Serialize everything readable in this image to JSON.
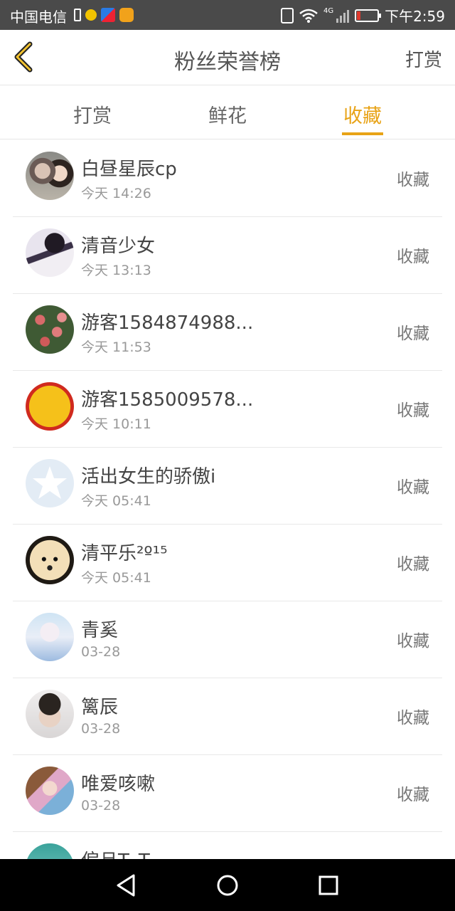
{
  "status_bar": {
    "carrier": "中国电信",
    "network": "4G",
    "time": "下午2:59",
    "icons": [
      "battery-saver-icon",
      "bulb-icon",
      "video-app-icon",
      "weibo-icon",
      "vibrate-icon",
      "wifi-icon",
      "signal-icon",
      "battery-icon"
    ]
  },
  "header": {
    "back_icon": "chevron-left-icon",
    "title": "粉丝荣誉榜",
    "action": "打赏"
  },
  "tabs": [
    {
      "label": "打赏",
      "active": false
    },
    {
      "label": "鲜花",
      "active": false
    },
    {
      "label": "收藏",
      "active": true
    }
  ],
  "accent_color": "#e8a317",
  "list": [
    {
      "name": "白昼星辰cp",
      "time": "今天 14:26",
      "tag": "收藏"
    },
    {
      "name": "清音少女",
      "time": "今天 13:13",
      "tag": "收藏"
    },
    {
      "name": "游客1584874988...",
      "time": "今天 11:53",
      "tag": "收藏"
    },
    {
      "name": "游客1585009578...",
      "time": "今天 10:11",
      "tag": "收藏"
    },
    {
      "name": "活出女生的骄傲i",
      "time": "今天 05:41",
      "tag": "收藏"
    },
    {
      "name": "清平乐²º¹⁵",
      "time": "今天 05:41",
      "tag": "收藏"
    },
    {
      "name": "青奚",
      "time": "03-28",
      "tag": "收藏"
    },
    {
      "name": "篱辰",
      "time": "03-28",
      "tag": "收藏"
    },
    {
      "name": "唯爱咳嗽",
      "time": "03-28",
      "tag": "收藏"
    },
    {
      "name": "偏旦T_T",
      "time": "",
      "tag": ""
    }
  ],
  "nav_bar": [
    "back-triangle-icon",
    "home-circle-icon",
    "recents-square-icon"
  ]
}
